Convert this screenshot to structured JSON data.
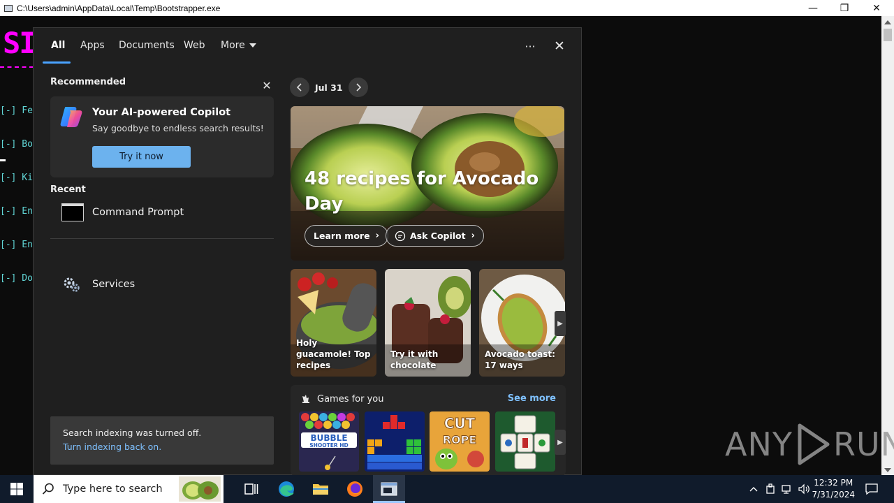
{
  "window": {
    "title": "C:\\Users\\admin\\AppData\\Local\\Temp\\Bootstrapper.exe",
    "minimize": "—",
    "maximize": "❐",
    "close": "✕"
  },
  "console": {
    "banner": "SI",
    "lines": [
      "[-] Fe",
      "[-] Bo",
      "[-] Ki",
      "[-] En",
      "[-] En",
      "[-] Do"
    ]
  },
  "search": {
    "tabs": [
      {
        "label": "All",
        "active": true
      },
      {
        "label": "Apps"
      },
      {
        "label": "Documents"
      },
      {
        "label": "Web"
      },
      {
        "label": "More"
      }
    ],
    "more_options": "···",
    "close": "✕",
    "recommended": {
      "label": "Recommended",
      "dismiss": "✕",
      "card": {
        "title": "Your AI-powered Copilot",
        "subtitle": "Say goodbye to endless search results!",
        "button": "Try it now"
      }
    },
    "recent": {
      "label": "Recent",
      "items": [
        {
          "label": "Command Prompt",
          "icon": "command-prompt-icon"
        },
        {
          "label": "Services",
          "icon": "services-gear-icon"
        }
      ]
    },
    "indexing": {
      "message": "Search indexing was turned off.",
      "link": "Turn indexing back on."
    },
    "highlights": {
      "date": "Jul 31",
      "hero": {
        "title": "48 recipes for Avocado Day",
        "learn_more": "Learn more",
        "ask_copilot": "Ask Copilot"
      },
      "cards": [
        {
          "caption": "Holy guacamole! Top recipes"
        },
        {
          "caption": "Try it with chocolate"
        },
        {
          "caption": "Avocado toast: 17 ways"
        }
      ],
      "games": {
        "title": "Games for you",
        "see_more": "See more",
        "items": [
          "Bubble Shooter HD",
          "Tetris-style Blocks",
          "Cut the Rope",
          "Mahjong"
        ]
      }
    }
  },
  "taskbar": {
    "search_placeholder": "Type here to search",
    "time": "12:32 PM",
    "date": "7/31/2024"
  },
  "watermark": {
    "left": "ANY",
    "right": "RUN"
  },
  "colors": {
    "accent": "#4aa3ff",
    "link": "#7fc1ff",
    "button": "#6cb2ee",
    "panel_bg": "#1f1f1f",
    "taskbar_bg": "#101b2b"
  }
}
